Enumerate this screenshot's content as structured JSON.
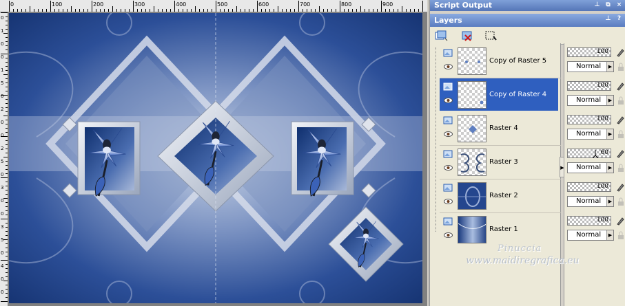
{
  "ruler": {
    "top_labels": [
      "0",
      "100",
      "200",
      "300",
      "400",
      "500",
      "600",
      "700",
      "800",
      "900"
    ],
    "left_labels": [
      "0",
      "1",
      "0",
      "0",
      "1",
      "5",
      "0",
      "2",
      "0",
      "0",
      "2",
      "5",
      "0",
      "3",
      "0",
      "0",
      "3",
      "5",
      "0",
      "4",
      "0",
      "0"
    ]
  },
  "script_output": {
    "title": "Script Output",
    "icons": [
      "pin-icon",
      "maximize-icon",
      "close-icon"
    ]
  },
  "layers_panel": {
    "title": "Layers",
    "icons": [
      "pin-icon",
      "help-icon"
    ],
    "toolbar": [
      "new-layer-icon",
      "delete-layer-icon",
      "mask-icon"
    ],
    "layers": [
      {
        "name": "Copy of Raster 5",
        "opacity": "100",
        "blend": "Normal",
        "selected": false,
        "thumb": "transparent-dots"
      },
      {
        "name": "Copy of Raster 4",
        "opacity": "100",
        "blend": "Normal",
        "selected": true,
        "thumb": "transparent-dot"
      },
      {
        "name": "Raster 4",
        "opacity": "100",
        "blend": "Normal",
        "selected": false,
        "thumb": "transparent-diamond"
      },
      {
        "name": "Raster 3",
        "opacity": "60",
        "blend": "Normal",
        "selected": false,
        "thumb": "pattern"
      },
      {
        "name": "Raster 2",
        "opacity": "100",
        "blend": "Normal",
        "selected": false,
        "thumb": "blue-abstract"
      },
      {
        "name": "Raster 1",
        "opacity": "100",
        "blend": "Normal",
        "selected": false,
        "thumb": "blue-gradient"
      }
    ]
  },
  "watermark": {
    "line1": "Pinuccia",
    "line2": "www.maidiregrafica.eu"
  },
  "colors": {
    "art_base": "#1d3d82",
    "art_light": "#dfe6f0",
    "selection": "#2f5fbf",
    "panel_title": "#5576b8"
  }
}
